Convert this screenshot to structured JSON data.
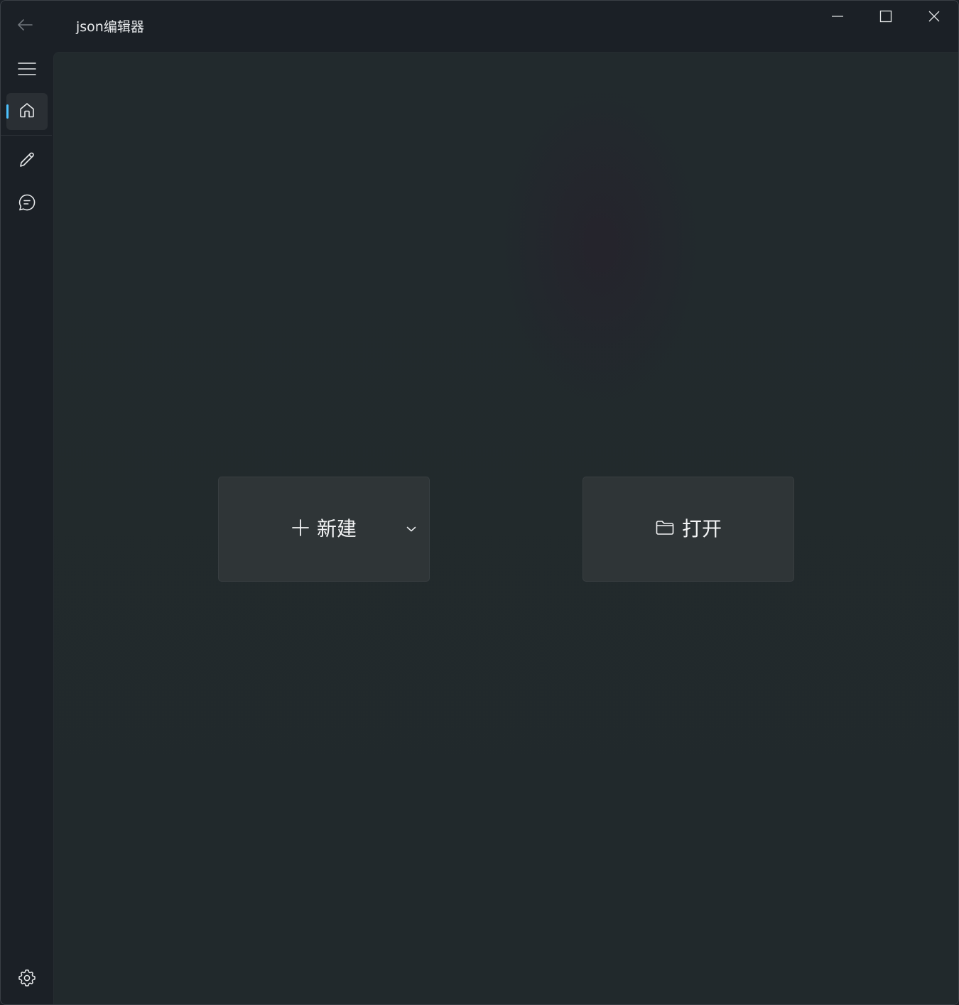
{
  "titlebar": {
    "title": "json编辑器",
    "back_icon": "arrow-left-icon",
    "minimize_icon": "minimize-icon",
    "maximize_icon": "maximize-icon",
    "close_icon": "close-icon"
  },
  "nav": {
    "items": [
      {
        "icon": "hamburger-menu-icon"
      },
      {
        "icon": "home-icon",
        "selected": true
      },
      {
        "icon": "pencil-edit-icon"
      },
      {
        "icon": "chat-bubble-icon"
      }
    ],
    "footer": {
      "icon": "gear-settings-icon"
    },
    "accent": "#4cc2ff"
  },
  "main": {
    "new_button": {
      "label": "新建",
      "icon": "plus-icon",
      "dropdown_icon": "chevron-down-icon"
    },
    "open_button": {
      "label": "打开",
      "icon": "folder-icon"
    }
  }
}
